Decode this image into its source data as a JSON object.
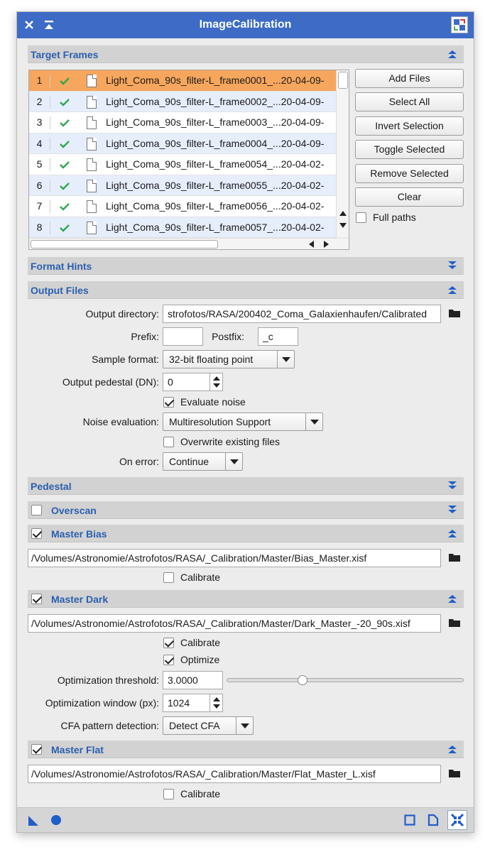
{
  "window": {
    "title": "ImageCalibration"
  },
  "titlebar": {
    "close_glyph": "✕",
    "shade_glyph": "⏶"
  },
  "sections": {
    "target_frames": "Target Frames",
    "format_hints": "Format Hints",
    "output_files": "Output Files",
    "pedestal": "Pedestal",
    "overscan": "Overscan",
    "master_bias": "Master Bias",
    "master_dark": "Master Dark",
    "master_flat": "Master Flat"
  },
  "section_checks": {
    "overscan": false,
    "master_bias": true,
    "master_dark": true,
    "master_flat": true
  },
  "target_frames": {
    "rows": [
      {
        "num": "1",
        "name": "Light_Coma_90s_filter-L_frame0001_...20-04-09-"
      },
      {
        "num": "2",
        "name": "Light_Coma_90s_filter-L_frame0002_...20-04-09-"
      },
      {
        "num": "3",
        "name": "Light_Coma_90s_filter-L_frame0003_...20-04-09-"
      },
      {
        "num": "4",
        "name": "Light_Coma_90s_filter-L_frame0004_...20-04-09-"
      },
      {
        "num": "5",
        "name": "Light_Coma_90s_filter-L_frame0054_...20-04-02-"
      },
      {
        "num": "6",
        "name": "Light_Coma_90s_filter-L_frame0055_...20-04-02-"
      },
      {
        "num": "7",
        "name": "Light_Coma_90s_filter-L_frame0056_...20-04-02-"
      },
      {
        "num": "8",
        "name": "Light_Coma_90s_filter-L_frame0057_...20-04-02-"
      }
    ],
    "selected_row": 1,
    "buttons": {
      "add_files": "Add Files",
      "select_all": "Select All",
      "invert_selection": "Invert Selection",
      "toggle_selected": "Toggle Selected",
      "remove_selected": "Remove Selected",
      "clear": "Clear"
    },
    "full_paths_label": "Full paths",
    "full_paths_checked": false
  },
  "output_files": {
    "output_directory_label": "Output directory:",
    "output_directory_value": "strofotos/RASA/200402_Coma_Galaxienhaufen/Calibrated",
    "prefix_label": "Prefix:",
    "prefix_value": "",
    "postfix_label": "Postfix:",
    "postfix_value": "_c",
    "sample_format_label": "Sample format:",
    "sample_format_value": "32-bit floating point",
    "output_pedestal_label": "Output pedestal (DN):",
    "output_pedestal_value": "0",
    "evaluate_noise_label": "Evaluate noise",
    "evaluate_noise_checked": true,
    "noise_evaluation_label": "Noise evaluation:",
    "noise_evaluation_value": "Multiresolution Support",
    "overwrite_label": "Overwrite existing files",
    "overwrite_checked": false,
    "on_error_label": "On error:",
    "on_error_value": "Continue"
  },
  "master_bias": {
    "path": "/Volumes/Astronomie/Astrofotos/RASA/_Calibration/Master/Bias_Master.xisf",
    "calibrate_label": "Calibrate",
    "calibrate_checked": false
  },
  "master_dark": {
    "path": "/Volumes/Astronomie/Astrofotos/RASA/_Calibration/Master/Dark_Master_-20_90s.xisf",
    "calibrate_label": "Calibrate",
    "calibrate_checked": true,
    "optimize_label": "Optimize",
    "optimize_checked": true,
    "opt_threshold_label": "Optimization threshold:",
    "opt_threshold_value": "3.0000",
    "opt_threshold_slider": 0.32,
    "opt_window_label": "Optimization window (px):",
    "opt_window_value": "1024",
    "cfa_label": "CFA pattern detection:",
    "cfa_value": "Detect CFA"
  },
  "master_flat": {
    "path": "/Volumes/Astronomie/Astrofotos/RASA/_Calibration/Master/Flat_Master_L.xisf",
    "calibrate_label": "Calibrate",
    "calibrate_checked": false
  },
  "colors": {
    "titlebar": "#3d6bc6",
    "section_text": "#2a5fb0",
    "selected_row": "#f6a65d",
    "alt_row": "#e6eefc",
    "checkmark": "#2fa84f",
    "icon_blue": "#1f5fc8"
  }
}
